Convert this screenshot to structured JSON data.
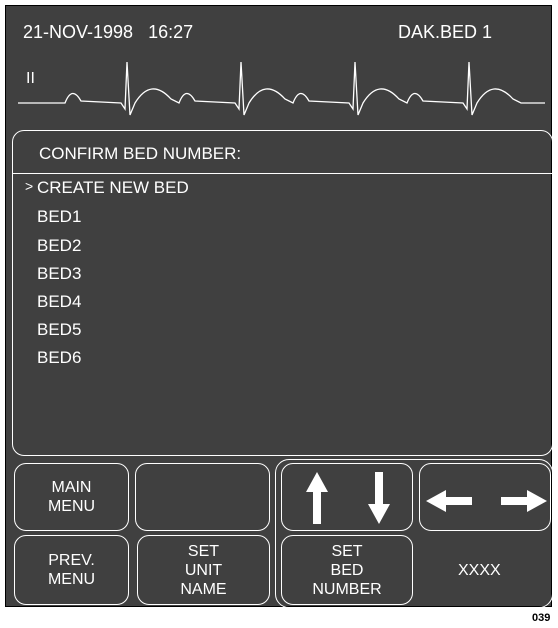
{
  "header": {
    "date_time": "21-NOV-1998   16:27",
    "bed_label": "DAK.BED 1"
  },
  "ecg": {
    "lead": "II"
  },
  "menu": {
    "title": "CONFIRM BED NUMBER:",
    "cursor": ">",
    "items": [
      "CREATE NEW BED",
      "BED1",
      "BED2",
      "BED3",
      "BED4",
      "BED5",
      "BED6"
    ]
  },
  "buttons": {
    "main_menu": "MAIN\nMENU",
    "prev_menu": "PREV.\nMENU",
    "set_unit_name": "SET\nUNIT\nNAME",
    "set_bed_number": "SET\nBED\nNUMBER",
    "xxxx": "XXXX"
  },
  "figure_tag": "039",
  "icons": {
    "up": "arrow-up-icon",
    "down": "arrow-down-icon",
    "left": "arrow-left-icon",
    "right": "arrow-right-icon"
  },
  "colors": {
    "screen_bg": "#404040",
    "foreground": "#ffffff"
  }
}
